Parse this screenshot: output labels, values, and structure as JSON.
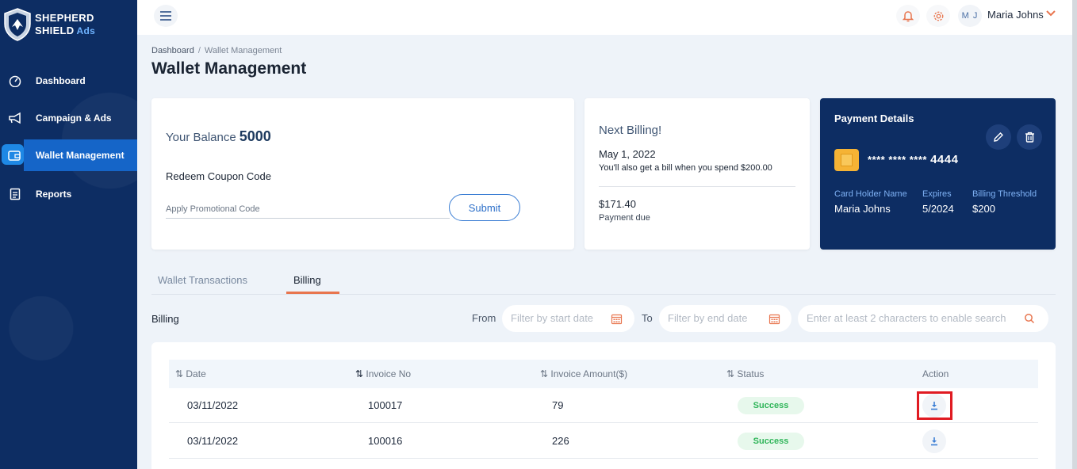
{
  "brand": {
    "line1": "SHEPHERD",
    "line2": "SHIELD",
    "ads": "Ads"
  },
  "sidebar": {
    "items": [
      {
        "label": "Dashboard",
        "icon": "gauge-icon"
      },
      {
        "label": "Campaign & Ads",
        "icon": "megaphone-icon"
      },
      {
        "label": "Wallet Management",
        "icon": "wallet-icon",
        "active": true
      },
      {
        "label": "Reports",
        "icon": "report-icon"
      }
    ]
  },
  "topbar": {
    "user_initials": "M J",
    "user_name": "Maria Johns"
  },
  "breadcrumb": {
    "home": "Dashboard",
    "separator": "/",
    "current": "Wallet Management"
  },
  "page_title": "Wallet Management",
  "balance": {
    "label": "Your Balance",
    "value": "5000",
    "coupon_label": "Redeem Coupon Code",
    "coupon_placeholder": "Apply Promotional Code",
    "submit_label": "Submit"
  },
  "next_billing": {
    "title": "Next Billing!",
    "date": "May 1, 2022",
    "note": "You'll also get a bill when you spend $200.00",
    "amount": "$171.40",
    "due_label": "Payment due"
  },
  "payment": {
    "title": "Payment Details",
    "card_mask": "**** **** ****",
    "card_last4": "4444",
    "holder_label": "Card Holder Name",
    "holder_value": "Maria Johns",
    "expires_label": "Expires",
    "expires_value": "5/2024",
    "threshold_label": "Billing Threshold",
    "threshold_value": "$200"
  },
  "tabs": [
    {
      "label": "Wallet Transactions",
      "active": false
    },
    {
      "label": "Billing",
      "active": true
    }
  ],
  "filters": {
    "section_label": "Billing",
    "from_label": "From",
    "from_placeholder": "Filter by start date",
    "to_label": "To",
    "to_placeholder": "Filter by end date",
    "search_placeholder": "Enter at least 2 characters to enable search"
  },
  "table": {
    "columns": [
      "Date",
      "Invoice No",
      "Invoice Amount($)",
      "Status",
      "Action"
    ],
    "rows": [
      {
        "date": "03/11/2022",
        "invoice": "100017",
        "amount": "79",
        "status": "Success"
      },
      {
        "date": "03/11/2022",
        "invoice": "100016",
        "amount": "226",
        "status": "Success"
      }
    ]
  },
  "colors": {
    "sidebar_bg": "#0d2d63",
    "accent_blue": "#1565c8",
    "accent_orange": "#e8754e",
    "success_green": "#2fb559",
    "highlight_red": "#e01b22"
  }
}
